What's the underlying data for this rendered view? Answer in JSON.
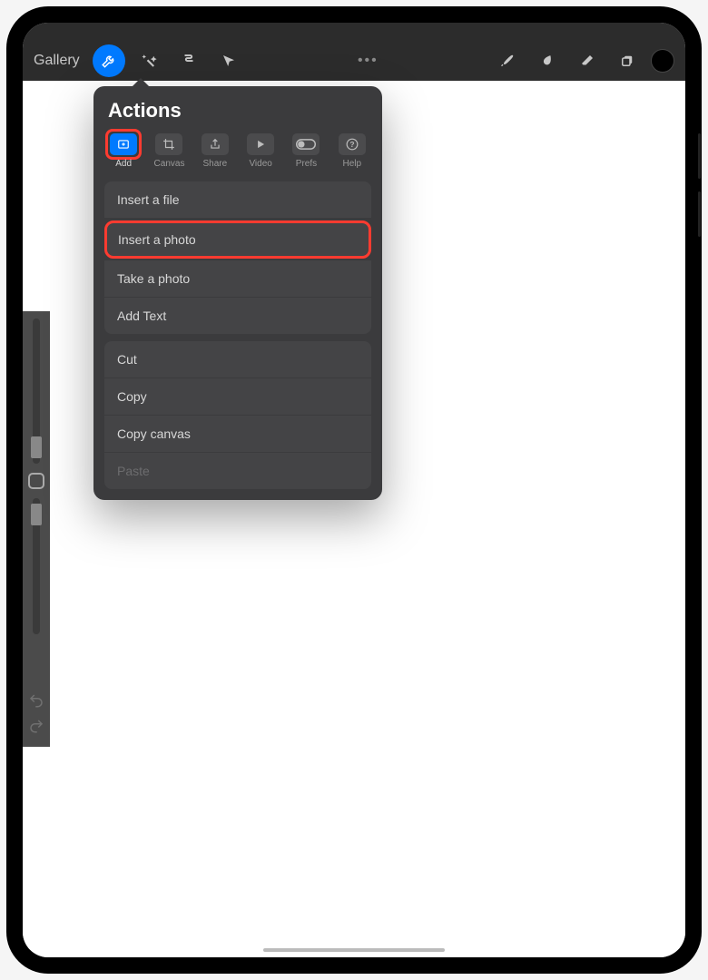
{
  "toolbar": {
    "gallery_label": "Gallery"
  },
  "popover": {
    "title": "Actions",
    "tabs": [
      {
        "label": "Add",
        "active": true,
        "highlighted": true
      },
      {
        "label": "Canvas"
      },
      {
        "label": "Share"
      },
      {
        "label": "Video"
      },
      {
        "label": "Prefs"
      },
      {
        "label": "Help"
      }
    ],
    "section1": [
      {
        "label": "Insert a file"
      },
      {
        "label": "Insert a photo",
        "highlighted": true
      },
      {
        "label": "Take a photo"
      },
      {
        "label": "Add Text"
      }
    ],
    "section2": [
      {
        "label": "Cut"
      },
      {
        "label": "Copy"
      },
      {
        "label": "Copy canvas"
      },
      {
        "label": "Paste",
        "disabled": true
      }
    ]
  }
}
